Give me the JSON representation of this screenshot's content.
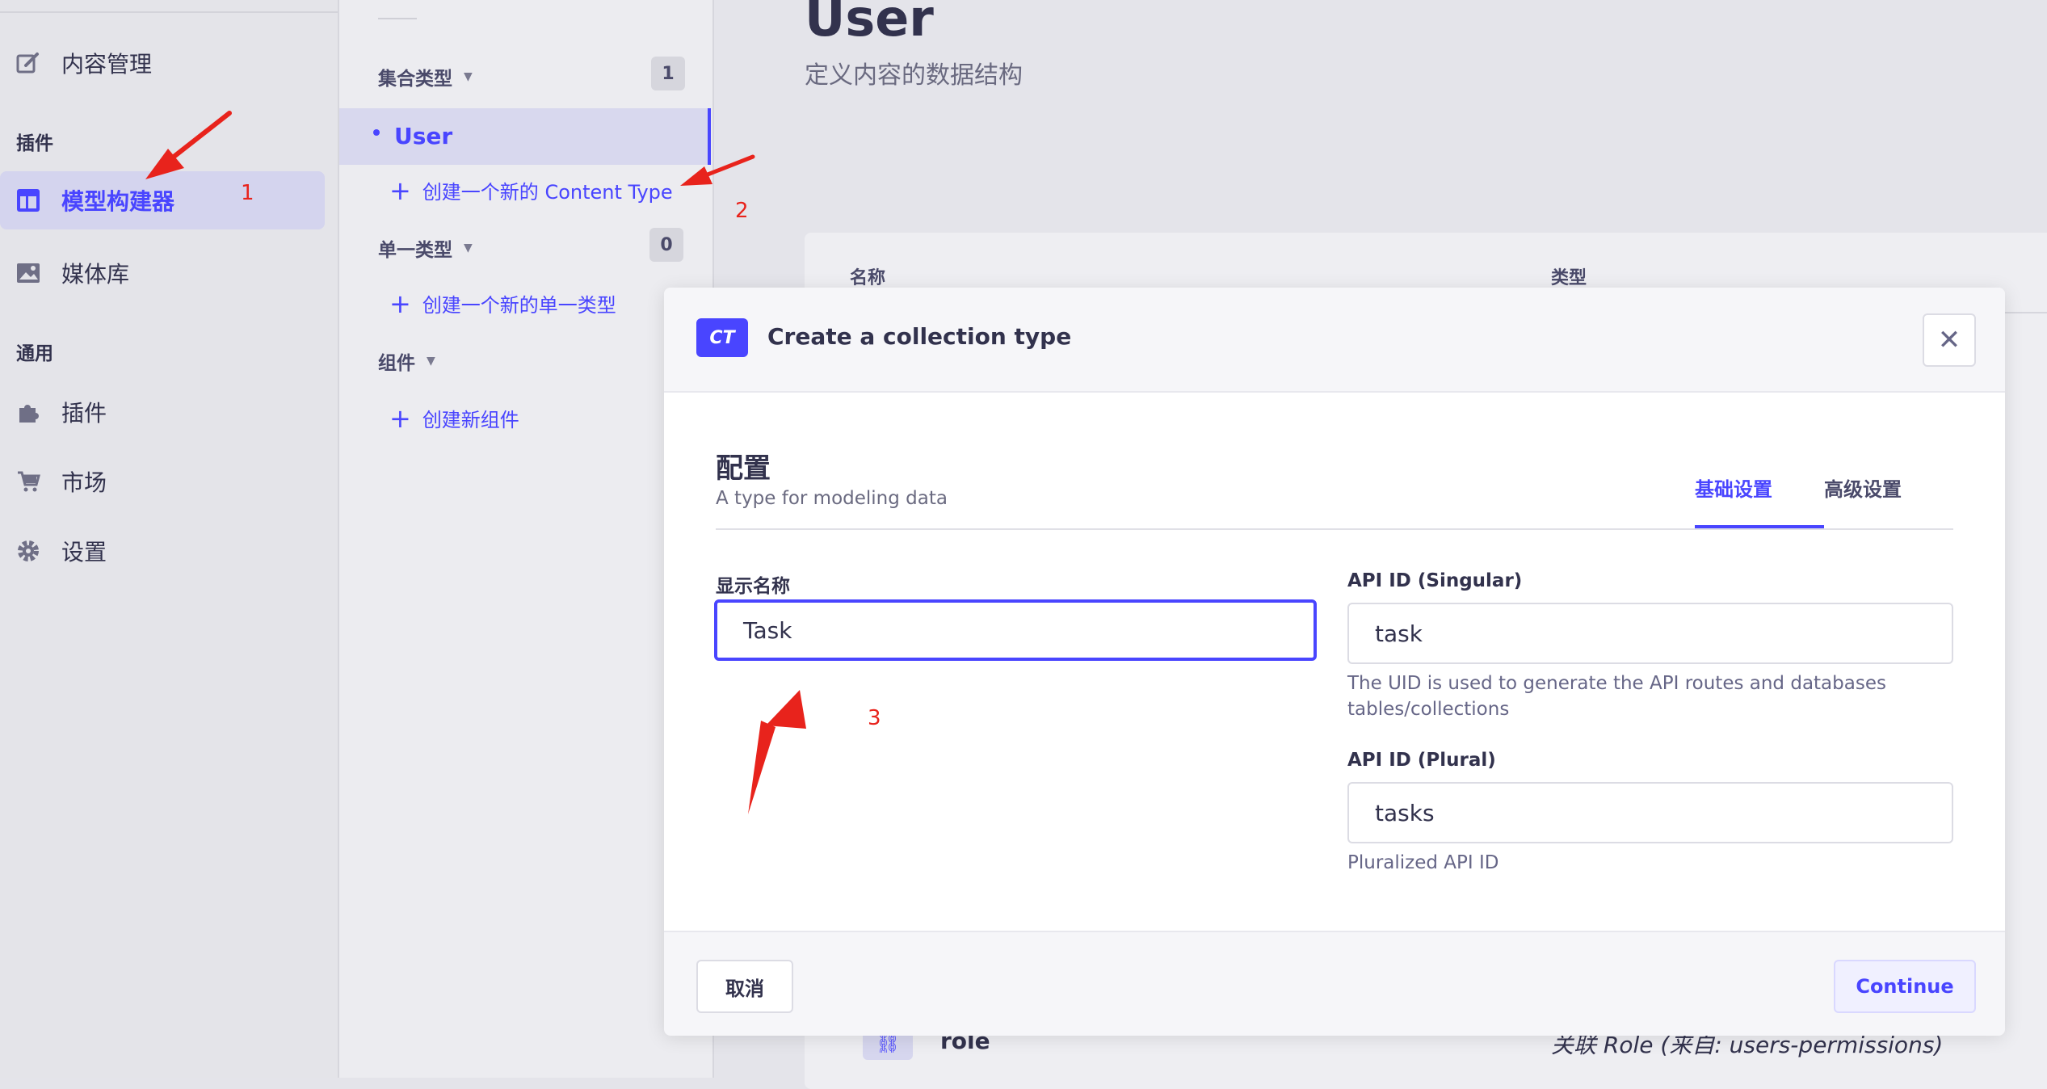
{
  "nav": {
    "content_manager": "内容管理",
    "plugins_section": "插件",
    "model_builder": "模型构建器",
    "media_library": "媒体库",
    "general_section": "通用",
    "plugins": "插件",
    "marketplace": "市场",
    "settings": "设置"
  },
  "sub": {
    "collection_types": "集合类型",
    "collection_count": "1",
    "user_item": "User",
    "create_content_type": "创建一个新的 Content Type",
    "single_types": "单一类型",
    "single_count": "0",
    "create_single_type": "创建一个新的单一类型",
    "components": "组件",
    "create_component": "创建新组件"
  },
  "main": {
    "title": "User",
    "subtitle": "定义内容的数据结构",
    "col_name": "名称",
    "col_type": "类型",
    "row_name": "role",
    "row_type": "关联 Role (来自: users-permissions)"
  },
  "modal": {
    "badge": "CT",
    "title": "Create a collection type",
    "close_symbol": "✕",
    "config_title": "配置",
    "config_subtitle": "A type for modeling data",
    "tab_basic": "基础设置",
    "tab_advanced": "高级设置",
    "display_name_label": "显示名称",
    "display_name_value": "Task",
    "api_singular_label": "API ID (Singular)",
    "api_singular_value": "task",
    "api_singular_hint": "The UID is used to generate the API routes and databases tables/collections",
    "api_plural_label": "API ID (Plural)",
    "api_plural_value": "tasks",
    "api_plural_hint": "Pluralized API ID",
    "cancel": "取消",
    "continue": "Continue"
  },
  "annotations": {
    "step1": "1",
    "step2": "2",
    "step3": "3"
  },
  "colors": {
    "accent": "#4945ff",
    "annotation": "#e8231c"
  }
}
